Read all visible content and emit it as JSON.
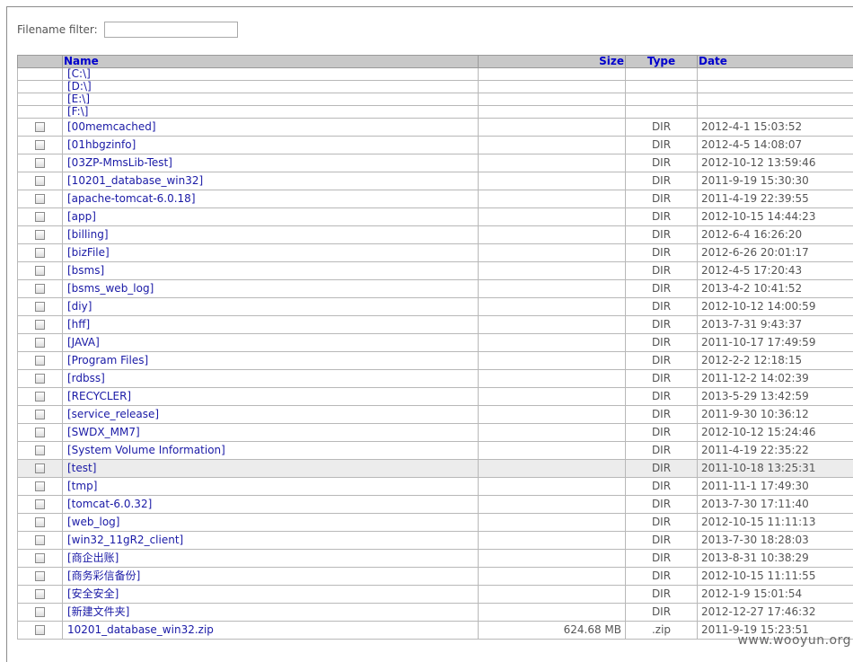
{
  "filter": {
    "label": "Filename filter:",
    "value": ""
  },
  "headers": {
    "name": "Name",
    "size": "Size",
    "type": "Type",
    "date": "Date"
  },
  "drives": [
    "[C:\\]",
    "[D:\\]",
    "[E:\\]",
    "[F:\\]"
  ],
  "rows": [
    {
      "name": "[00memcached]",
      "size": "",
      "type": "DIR",
      "date": "2012-4-1 15:03:52"
    },
    {
      "name": "[01hbgzinfo]",
      "size": "",
      "type": "DIR",
      "date": "2012-4-5 14:08:07"
    },
    {
      "name": "[03ZP-MmsLib-Test]",
      "size": "",
      "type": "DIR",
      "date": "2012-10-12 13:59:46"
    },
    {
      "name": "[10201_database_win32]",
      "size": "",
      "type": "DIR",
      "date": "2011-9-19 15:30:30"
    },
    {
      "name": "[apache-tomcat-6.0.18]",
      "size": "",
      "type": "DIR",
      "date": "2011-4-19 22:39:55"
    },
    {
      "name": "[app]",
      "size": "",
      "type": "DIR",
      "date": "2012-10-15 14:44:23"
    },
    {
      "name": "[billing]",
      "size": "",
      "type": "DIR",
      "date": "2012-6-4 16:26:20"
    },
    {
      "name": "[bizFile]",
      "size": "",
      "type": "DIR",
      "date": "2012-6-26 20:01:17"
    },
    {
      "name": "[bsms]",
      "size": "",
      "type": "DIR",
      "date": "2012-4-5 17:20:43"
    },
    {
      "name": "[bsms_web_log]",
      "size": "",
      "type": "DIR",
      "date": "2013-4-2 10:41:52"
    },
    {
      "name": "[diy]",
      "size": "",
      "type": "DIR",
      "date": "2012-10-12 14:00:59"
    },
    {
      "name": "[hff]",
      "size": "",
      "type": "DIR",
      "date": "2013-7-31 9:43:37"
    },
    {
      "name": "[JAVA]",
      "size": "",
      "type": "DIR",
      "date": "2011-10-17 17:49:59"
    },
    {
      "name": "[Program Files]",
      "size": "",
      "type": "DIR",
      "date": "2012-2-2 12:18:15"
    },
    {
      "name": "[rdbss]",
      "size": "",
      "type": "DIR",
      "date": "2011-12-2 14:02:39"
    },
    {
      "name": "[RECYCLER]",
      "size": "",
      "type": "DIR",
      "date": "2013-5-29 13:42:59"
    },
    {
      "name": "[service_release]",
      "size": "",
      "type": "DIR",
      "date": "2011-9-30 10:36:12"
    },
    {
      "name": "[SWDX_MM7]",
      "size": "",
      "type": "DIR",
      "date": "2012-10-12 15:24:46"
    },
    {
      "name": "[System Volume Information]",
      "size": "",
      "type": "DIR",
      "date": "2011-4-19 22:35:22"
    },
    {
      "name": "[test]",
      "size": "",
      "type": "DIR",
      "date": "2011-10-18 13:25:31",
      "highlight": true
    },
    {
      "name": "[tmp]",
      "size": "",
      "type": "DIR",
      "date": "2011-11-1 17:49:30"
    },
    {
      "name": "[tomcat-6.0.32]",
      "size": "",
      "type": "DIR",
      "date": "2013-7-30 17:11:40"
    },
    {
      "name": "[web_log]",
      "size": "",
      "type": "DIR",
      "date": "2012-10-15 11:11:13"
    },
    {
      "name": "[win32_11gR2_client]",
      "size": "",
      "type": "DIR",
      "date": "2013-7-30 18:28:03"
    },
    {
      "name": "[商企出账]",
      "size": "",
      "type": "DIR",
      "date": "2013-8-31 10:38:29"
    },
    {
      "name": "[商务彩信备份]",
      "size": "",
      "type": "DIR",
      "date": "2012-10-15 11:11:55"
    },
    {
      "name": "[安全安全]",
      "size": "",
      "type": "DIR",
      "date": "2012-1-9 15:01:54"
    },
    {
      "name": "[新建文件夹]",
      "size": "",
      "type": "DIR",
      "date": "2012-12-27 17:46:32"
    },
    {
      "name": "10201_database_win32.zip",
      "size": "624.68 MB",
      "type": ".zip",
      "date": "2011-9-19 15:23:51"
    }
  ],
  "watermark": "www.wooyun.org"
}
